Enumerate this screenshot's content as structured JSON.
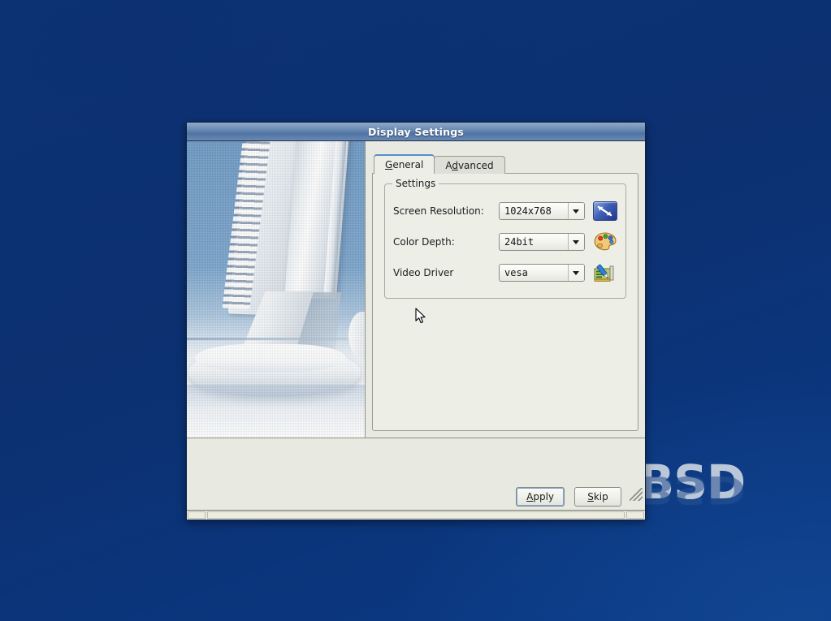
{
  "desktop": {
    "wordmark": "BSD",
    "wordmark_reflection": "BSD",
    "background_color": "#0d3478",
    "cursor": "arrow-pointer"
  },
  "window": {
    "title": "Display Settings",
    "titlebar_color": "#4e73a4"
  },
  "preview": {
    "alt": "photo of an LCD monitor stand on a blue background"
  },
  "tabs": [
    {
      "label": "General",
      "mnemonic": "G",
      "rest": "eneral",
      "active": true
    },
    {
      "label": "Advanced",
      "mnemonic": "d",
      "pre": "A",
      "rest": "vanced",
      "active": false
    }
  ],
  "settings": {
    "legend": "Settings",
    "rows": [
      {
        "label": "Screen Resolution:",
        "value": "1024x768",
        "icon": "screen-resolution-icon"
      },
      {
        "label": "Color Depth:",
        "value": "24bit",
        "icon": "color-palette-icon"
      },
      {
        "label": "Video Driver",
        "value": "vesa",
        "icon": "video-driver-icon"
      }
    ]
  },
  "buttons": {
    "apply": {
      "label": "Apply",
      "mnemonic": "A",
      "rest": "pply",
      "focused": true
    },
    "skip": {
      "label": "Skip",
      "mnemonic": "S",
      "rest": "kip",
      "focused": false
    }
  },
  "statusbar": {
    "segment_left": "",
    "segment_center": "",
    "segment_right": ""
  }
}
